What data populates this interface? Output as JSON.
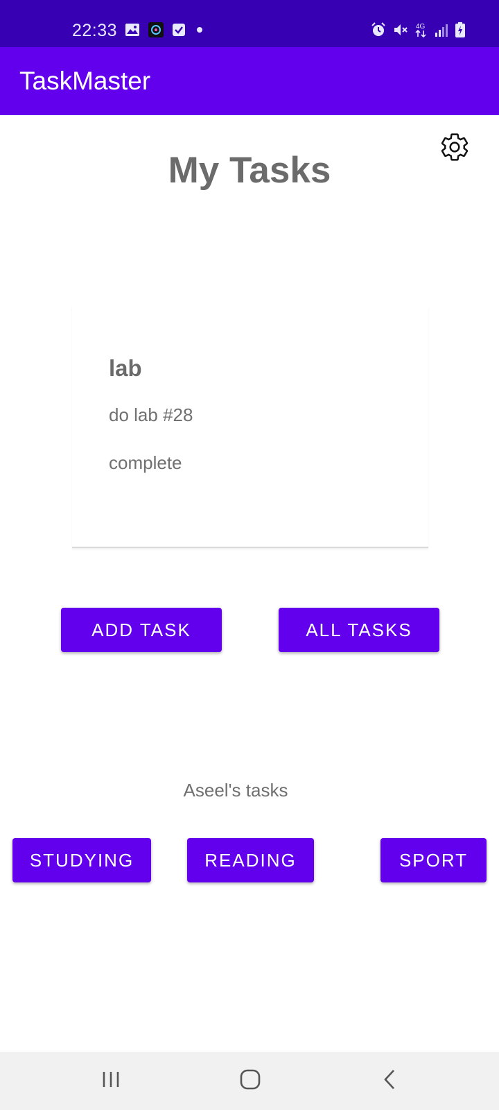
{
  "status_bar": {
    "time": "22:33",
    "left_icons": [
      "image-icon",
      "app-notification-icon",
      "checkbox-notification-icon",
      "dot-icon"
    ],
    "right_icons": [
      "alarm-icon",
      "mute-icon",
      "network-4g-icon",
      "signal-icon",
      "battery-charging-icon"
    ],
    "network_label": "4G"
  },
  "app_bar": {
    "title": "TaskMaster"
  },
  "settings": {
    "icon": "gear-icon"
  },
  "page": {
    "title": "My Tasks"
  },
  "task_card": {
    "title": "lab",
    "body": "do lab #28",
    "state": "complete"
  },
  "actions": {
    "add_task": "ADD TASK",
    "all_tasks": "ALL TASKS"
  },
  "user_tasks": {
    "label": "Aseel's tasks",
    "buttons": [
      "STUDYING",
      "READING",
      "SPORT"
    ]
  },
  "nav_bar": {
    "icons": [
      "recents-icon",
      "home-icon",
      "back-icon"
    ]
  },
  "colors": {
    "status_bar": "#3700b3",
    "primary": "#6200ee",
    "text_gray": "#6b6b6b"
  }
}
